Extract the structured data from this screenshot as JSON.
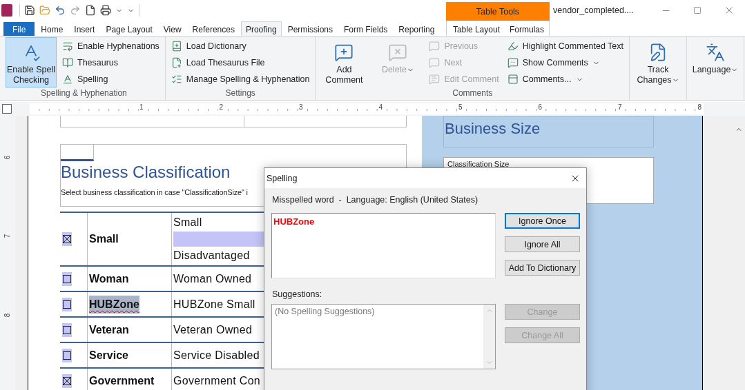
{
  "app": {
    "title": "vendor_completed....",
    "context_label": "Table Tools"
  },
  "tabs": [
    {
      "label": "File",
      "kind": "file",
      "selected": false
    },
    {
      "label": "Home",
      "kind": "normal",
      "selected": false
    },
    {
      "label": "Insert",
      "kind": "normal",
      "selected": false
    },
    {
      "label": "Page Layout",
      "kind": "normal",
      "selected": false
    },
    {
      "label": "View",
      "kind": "normal",
      "selected": false
    },
    {
      "label": "References",
      "kind": "normal",
      "selected": false
    },
    {
      "label": "Proofing",
      "kind": "normal",
      "selected": true
    },
    {
      "label": "Permissions",
      "kind": "normal",
      "selected": false
    },
    {
      "label": "Form Fields",
      "kind": "normal",
      "selected": false
    },
    {
      "label": "Reporting",
      "kind": "normal",
      "selected": false
    },
    {
      "label": "Table Layout",
      "kind": "context",
      "selected": false
    },
    {
      "label": "Formulas",
      "kind": "context",
      "selected": false
    }
  ],
  "ribbon_groups": [
    {
      "label": "Spelling & Hyphenation",
      "items": [
        {
          "label": "Enable Spell Checking",
          "kind": "large",
          "pressed": true,
          "disabled": false,
          "dropdown": false
        },
        {
          "label": "Enable Hyphenations",
          "kind": "small",
          "pressed": false,
          "disabled": false,
          "dropdown": false
        },
        {
          "label": "Thesaurus",
          "kind": "small",
          "pressed": false,
          "disabled": false,
          "dropdown": false
        },
        {
          "label": "Spelling",
          "kind": "small",
          "pressed": false,
          "disabled": false,
          "dropdown": false
        }
      ]
    },
    {
      "label": "Settings",
      "items": [
        {
          "label": "Load Dictionary",
          "kind": "small",
          "pressed": false,
          "disabled": false,
          "dropdown": false
        },
        {
          "label": "Load Thesaurus File",
          "kind": "small",
          "pressed": false,
          "disabled": false,
          "dropdown": false
        },
        {
          "label": "Manage Spelling & Hyphenation",
          "kind": "small",
          "pressed": false,
          "disabled": false,
          "dropdown": false
        }
      ]
    },
    {
      "label": "Comments",
      "items": [
        {
          "label": "Add Comment",
          "kind": "large",
          "pressed": false,
          "disabled": false,
          "dropdown": false
        },
        {
          "label": "Delete",
          "kind": "large",
          "pressed": false,
          "disabled": true,
          "dropdown": true
        },
        {
          "label": "Previous",
          "kind": "small",
          "pressed": false,
          "disabled": true,
          "dropdown": false
        },
        {
          "label": "Next",
          "kind": "small",
          "pressed": false,
          "disabled": true,
          "dropdown": false
        },
        {
          "label": "Edit Comment",
          "kind": "small",
          "pressed": false,
          "disabled": true,
          "dropdown": false
        },
        {
          "label": "Highlight Commented Text",
          "kind": "small",
          "pressed": false,
          "disabled": false,
          "dropdown": false
        },
        {
          "label": "Show Comments",
          "kind": "small",
          "pressed": false,
          "disabled": false,
          "dropdown": true
        },
        {
          "label": "Comments...",
          "kind": "small",
          "pressed": false,
          "disabled": false,
          "dropdown": true
        }
      ]
    },
    {
      "items": [
        {
          "label": "Track Changes",
          "kind": "large",
          "pressed": false,
          "disabled": false,
          "dropdown": true
        }
      ]
    },
    {
      "items": [
        {
          "label": "Language",
          "kind": "large",
          "pressed": false,
          "disabled": false,
          "dropdown": true
        }
      ]
    }
  ],
  "ruler": {
    "marks": [
      "1",
      "2",
      "3",
      "4",
      "5",
      "6",
      "7",
      "8"
    ]
  },
  "vertical_ruler": {
    "marks": [
      "6",
      "7",
      "8"
    ]
  },
  "classification": {
    "heading": "Business Classification",
    "instruction": "Select business classification in case \"ClassificationSize\" i",
    "rows": [
      {
        "checked": true,
        "name": "Small",
        "name_selected": false,
        "misspelled": false,
        "description": [
          {
            "kind": "text",
            "text": "Small"
          },
          {
            "kind": "field"
          },
          {
            "kind": "text",
            "text": "Disadvantaged"
          }
        ]
      },
      {
        "checked": false,
        "name": "Woman",
        "name_selected": false,
        "misspelled": false,
        "description": [
          {
            "kind": "text",
            "text": "Woman Owned"
          }
        ]
      },
      {
        "checked": false,
        "name": "HUBZone",
        "name_selected": true,
        "misspelled": true,
        "description": [
          {
            "kind": "text",
            "text": "HUBZone Small"
          }
        ]
      },
      {
        "checked": false,
        "name": "Veteran",
        "name_selected": false,
        "misspelled": false,
        "description": [
          {
            "kind": "text",
            "text": "Veteran Owned"
          }
        ]
      },
      {
        "checked": false,
        "name": "Service",
        "name_selected": false,
        "misspelled": false,
        "description": [
          {
            "kind": "text",
            "text": "Service Disabled"
          }
        ]
      },
      {
        "checked": true,
        "name": "Government",
        "name_selected": false,
        "misspelled": false,
        "description": [
          {
            "kind": "text",
            "text": "Government Con"
          }
        ]
      }
    ]
  },
  "size": {
    "heading": "Business Size",
    "field_label": "Classification Size"
  },
  "dialog": {
    "title": "Spelling",
    "language_line": "Misspelled word  -  Language: English (United States)",
    "misspelled_text": "HUBZone",
    "buttons": [
      {
        "label": "Ignore Once",
        "focused": true,
        "disabled": false
      },
      {
        "label": "Ignore All",
        "focused": false,
        "disabled": false
      },
      {
        "label": "Add To Dictionary",
        "focused": false,
        "disabled": false
      }
    ],
    "suggestions_label": "Suggestions:",
    "suggestions_note": "(No Spelling Suggestions)",
    "change_buttons": [
      {
        "label": "Change",
        "focused": false,
        "disabled": true
      },
      {
        "label": "Change All",
        "focused": false,
        "disabled": true
      }
    ]
  }
}
